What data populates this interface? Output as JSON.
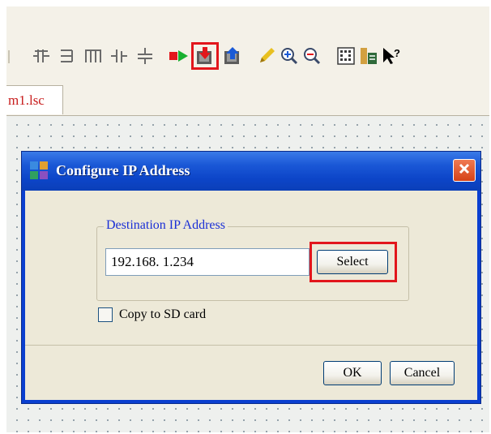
{
  "editor": {
    "tab_label": "m1.lsc"
  },
  "toolbar": {
    "icons": [
      "contact-open-icon",
      "contact-closed-icon",
      "coil-icon",
      "contact-branch-icon",
      "ground-line-icon",
      "run-arrow-icon",
      "download-icon",
      "upload-icon",
      "pencil-icon",
      "zoom-in-icon",
      "zoom-out-icon",
      "grid-icon",
      "monitor-icon",
      "help-pointer-icon"
    ],
    "highlighted": "download-icon"
  },
  "dialog": {
    "title": "Configure IP Address",
    "group_label": "Destination IP Address",
    "ip_value": "192.168. 1.234",
    "select_label": "Select",
    "copy_sd_label": "Copy to SD card",
    "copy_sd_checked": false,
    "ok_label": "OK",
    "cancel_label": "Cancel"
  },
  "colors": {
    "title_bar": "#0c45c8",
    "highlight": "#e2161c",
    "group_label": "#1a2fd6",
    "close_button": "#d54218"
  }
}
